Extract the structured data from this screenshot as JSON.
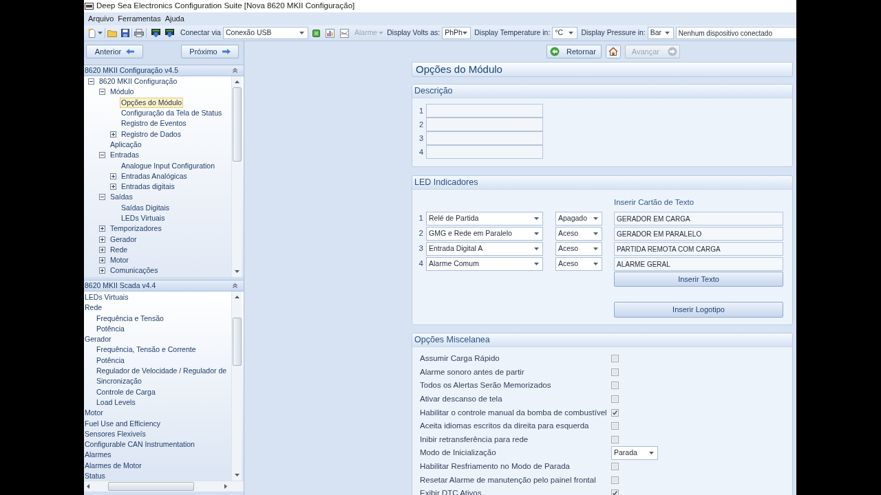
{
  "window": {
    "title": "Deep Sea Electronics Configuration Suite [Nova 8620 MKII Configuração]"
  },
  "menu": [
    "Arquivo",
    "Ferramentas",
    "Ajuda"
  ],
  "toolbar": {
    "connect_label": "Conectar via",
    "connection": "Conexão USB",
    "alarm": {
      "label": "Alarme",
      "disabled": true
    },
    "display_settings": [
      {
        "label": "Display Volts as:",
        "value": "PhPh"
      },
      {
        "label": "Display Temperature in:",
        "value": "°C"
      },
      {
        "label": "Display Pressure in:",
        "value": "Bar"
      }
    ],
    "device_status": "Nenhum dispositivo conectado"
  },
  "navigation": {
    "previous": "Anterior",
    "next": "Próximo"
  },
  "config_tree": {
    "title": "8620 MKII Configuração v4.5",
    "items": [
      {
        "label": "8620 MKII Configuração",
        "selected": false,
        "expanded": true,
        "children": [
          {
            "label": "Módulo",
            "selected": false,
            "expanded": true,
            "children": [
              {
                "label": "Opções do Módulo",
                "selected": true
              },
              {
                "label": "Configuração da Tela de Status",
                "selected": false
              },
              {
                "label": "Registro de Eventos",
                "selected": false
              },
              {
                "label": "Registro de Dados",
                "selected": false,
                "expanded": false
              }
            ]
          },
          {
            "label": "Aplicação",
            "selected": false
          },
          {
            "label": "Entradas",
            "selected": false,
            "expanded": true,
            "children": [
              {
                "label": "Analogue Input Configuration",
                "selected": false
              },
              {
                "label": "Entradas Analógicas",
                "selected": false,
                "expanded": false
              },
              {
                "label": "Entradas digitais",
                "selected": false,
                "expanded": false
              }
            ]
          },
          {
            "label": "Saídas",
            "selected": false,
            "expanded": true,
            "children": [
              {
                "label": "Saídas Digitais",
                "selected": false
              },
              {
                "label": "LEDs Virtuais",
                "selected": false
              }
            ]
          },
          {
            "label": "Temporizadores",
            "selected": false,
            "expanded": false
          },
          {
            "label": "Gerador",
            "selected": false,
            "expanded": false
          },
          {
            "label": "Rede",
            "selected": false,
            "expanded": false
          },
          {
            "label": "Motor",
            "selected": false,
            "expanded": false
          },
          {
            "label": "Comunicações",
            "selected": false,
            "expanded": false
          }
        ]
      }
    ]
  },
  "scada_tree": {
    "title": "8620 MKII Scada v4.4",
    "items": [
      {
        "label": "LEDs Virtuais",
        "selected": false
      },
      {
        "label": "Rede",
        "selected": false,
        "children": [
          {
            "label": "Frequência e Tensão",
            "selected": false
          },
          {
            "label": "Potência",
            "selected": false
          }
        ]
      },
      {
        "label": "Gerador",
        "selected": false,
        "children": [
          {
            "label": "Frequência, Tensão e Corrente",
            "selected": false
          },
          {
            "label": "Potência",
            "selected": false
          },
          {
            "label": "Regulador de Velocidade / Regulador de Sincronização",
            "selected": false
          },
          {
            "label": "Controle de Carga",
            "selected": false
          },
          {
            "label": "Load Levels",
            "selected": false
          }
        ]
      },
      {
        "label": "Motor",
        "selected": false
      },
      {
        "label": "Fuel Use and Efficiency",
        "selected": false
      },
      {
        "label": "Sensores Flexiveís",
        "selected": false
      },
      {
        "label": "Configurable CAN Instrumentation",
        "selected": false
      },
      {
        "label": "Alarmes",
        "selected": false
      },
      {
        "label": "Alarmes de Motor",
        "selected": false
      },
      {
        "label": "Status",
        "selected": false
      }
    ]
  },
  "page_nav": {
    "back": {
      "label": "Retornar",
      "disabled": false
    },
    "forward": {
      "label": "Avançar",
      "disabled": true
    }
  },
  "page": {
    "title": "Opções do Módulo",
    "description": {
      "title": "Descrição",
      "lines": [
        "1",
        "2",
        "3",
        "4"
      ]
    },
    "led_indicators": {
      "title": "LED Indicadores",
      "text_card_label": "Inserir Cartão de Texto",
      "rows": [
        {
          "number": "1",
          "source": "Relé de Partida",
          "state": "Apagado",
          "text": "GERADOR EM CARGA"
        },
        {
          "number": "2",
          "source": "GMG e Rede em Paralelo",
          "state": "Aceso",
          "text": "GERADOR EM PARALELO"
        },
        {
          "number": "3",
          "source": "Entrada Digital A",
          "state": "Aceso",
          "text": "PARTIDA REMOTA COM CARGA"
        },
        {
          "number": "4",
          "source": "Alarme Comum",
          "state": "Aceso",
          "text": "ALARME GERAL"
        }
      ],
      "insert_text_button": "Inserir Texto",
      "insert_logo_button": "Inserir Logotipo"
    },
    "misc_options": {
      "title": "Opções Miscelanea",
      "options": [
        {
          "kind": "checkbox",
          "label": "Assumir Carga Rápido",
          "checked": false
        },
        {
          "kind": "checkbox",
          "label": "Alarme sonoro antes de partir",
          "checked": false
        },
        {
          "kind": "checkbox",
          "label": "Todos os Alertas Serão Memorizados",
          "checked": false
        },
        {
          "kind": "checkbox",
          "label": "Ativar descanso de tela",
          "checked": false
        },
        {
          "kind": "checkbox",
          "label": "Habilitar o controle manual da bomba de combustível",
          "checked": true
        },
        {
          "kind": "checkbox",
          "label": "Aceita idiomas escritos da direita para esquerda",
          "checked": false
        },
        {
          "kind": "checkbox",
          "label": "Inibir retransferência para rede",
          "checked": false
        },
        {
          "kind": "select",
          "label": "Modo de Inicialização",
          "value": "Parada"
        },
        {
          "kind": "checkbox",
          "label": "Habilitar Resfriamento no Modo de Parada",
          "checked": false
        },
        {
          "kind": "checkbox",
          "label": "Resetar Alarme de manutenção pelo painel frontal",
          "checked": false
        },
        {
          "kind": "checkbox",
          "label": "Exibir DTC Ativos",
          "checked": true
        }
      ]
    }
  }
}
